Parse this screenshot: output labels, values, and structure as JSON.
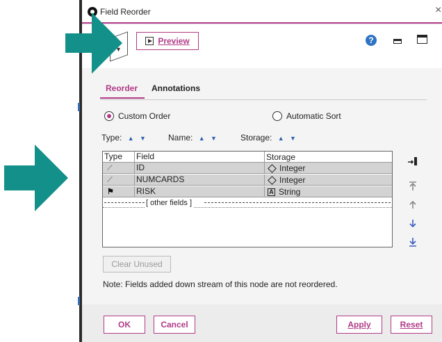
{
  "window": {
    "title": "Field Reorder",
    "close_glyph": "×"
  },
  "toolbar": {
    "preview_label": "Preview",
    "help_glyph": "?"
  },
  "tabs": [
    {
      "label": "Reorder",
      "active": true
    },
    {
      "label": "Annotations",
      "active": false
    }
  ],
  "order_mode": {
    "custom_label": "Custom Order",
    "automatic_label": "Automatic Sort",
    "selected": "Custom Order"
  },
  "sort_controls": {
    "type_label": "Type:",
    "name_label": "Name:",
    "storage_label": "Storage:",
    "up_glyph": "▲",
    "down_glyph": "▼"
  },
  "grid": {
    "columns": [
      "Type",
      "Field",
      "Storage"
    ],
    "rows": [
      {
        "type_icon": "continuous-icon",
        "field": "ID",
        "storage": "Integer",
        "storage_icon": "diamond-icon"
      },
      {
        "type_icon": "continuous-icon",
        "field": "NUMCARDS",
        "storage": "Integer",
        "storage_icon": "diamond-icon"
      },
      {
        "type_icon": "flag-icon",
        "field": "RISK",
        "storage": "String",
        "storage_icon": "string-a-icon"
      }
    ],
    "other_fields_label": "[ other fields ]",
    "string_glyph": "A"
  },
  "buttons": {
    "clear_unused": "Clear Unused",
    "ok": "OK",
    "cancel": "Cancel",
    "apply": "Apply",
    "reset": "Reset"
  },
  "note": "Note: Fields added down stream of this node are not reordered.",
  "colors": {
    "accent": "#b03a86",
    "arrow_overlay": "#13908a",
    "sort_arrow": "#2f5fb3"
  }
}
